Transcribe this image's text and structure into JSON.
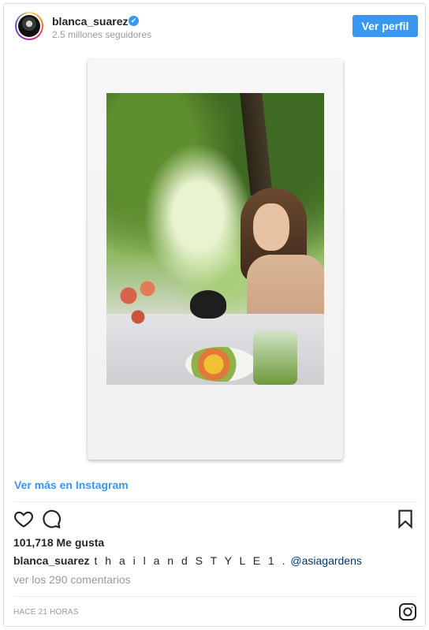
{
  "header": {
    "username": "blanca_suarez",
    "verified_mark": "✔",
    "followers": "2.5 millones seguidores",
    "view_profile_label": "Ver perfil"
  },
  "media": {
    "more_link": "Ver más en Instagram"
  },
  "actions": {
    "icons": [
      "heart-icon",
      "comment-icon",
      "bookmark-icon"
    ]
  },
  "likes": "101,718 Me gusta",
  "caption": {
    "user": "blanca_suarez",
    "text": "t h a i l a n d S T Y L E 1 .",
    "mention": "@asiagardens"
  },
  "comments_link": "ver los 290 comentarios",
  "timestamp": "HACE 21 HORAS",
  "colors": {
    "accent": "#3897f0",
    "text": "#262626",
    "muted": "#999999",
    "mention": "#003569",
    "border": "#dbdbdb"
  }
}
